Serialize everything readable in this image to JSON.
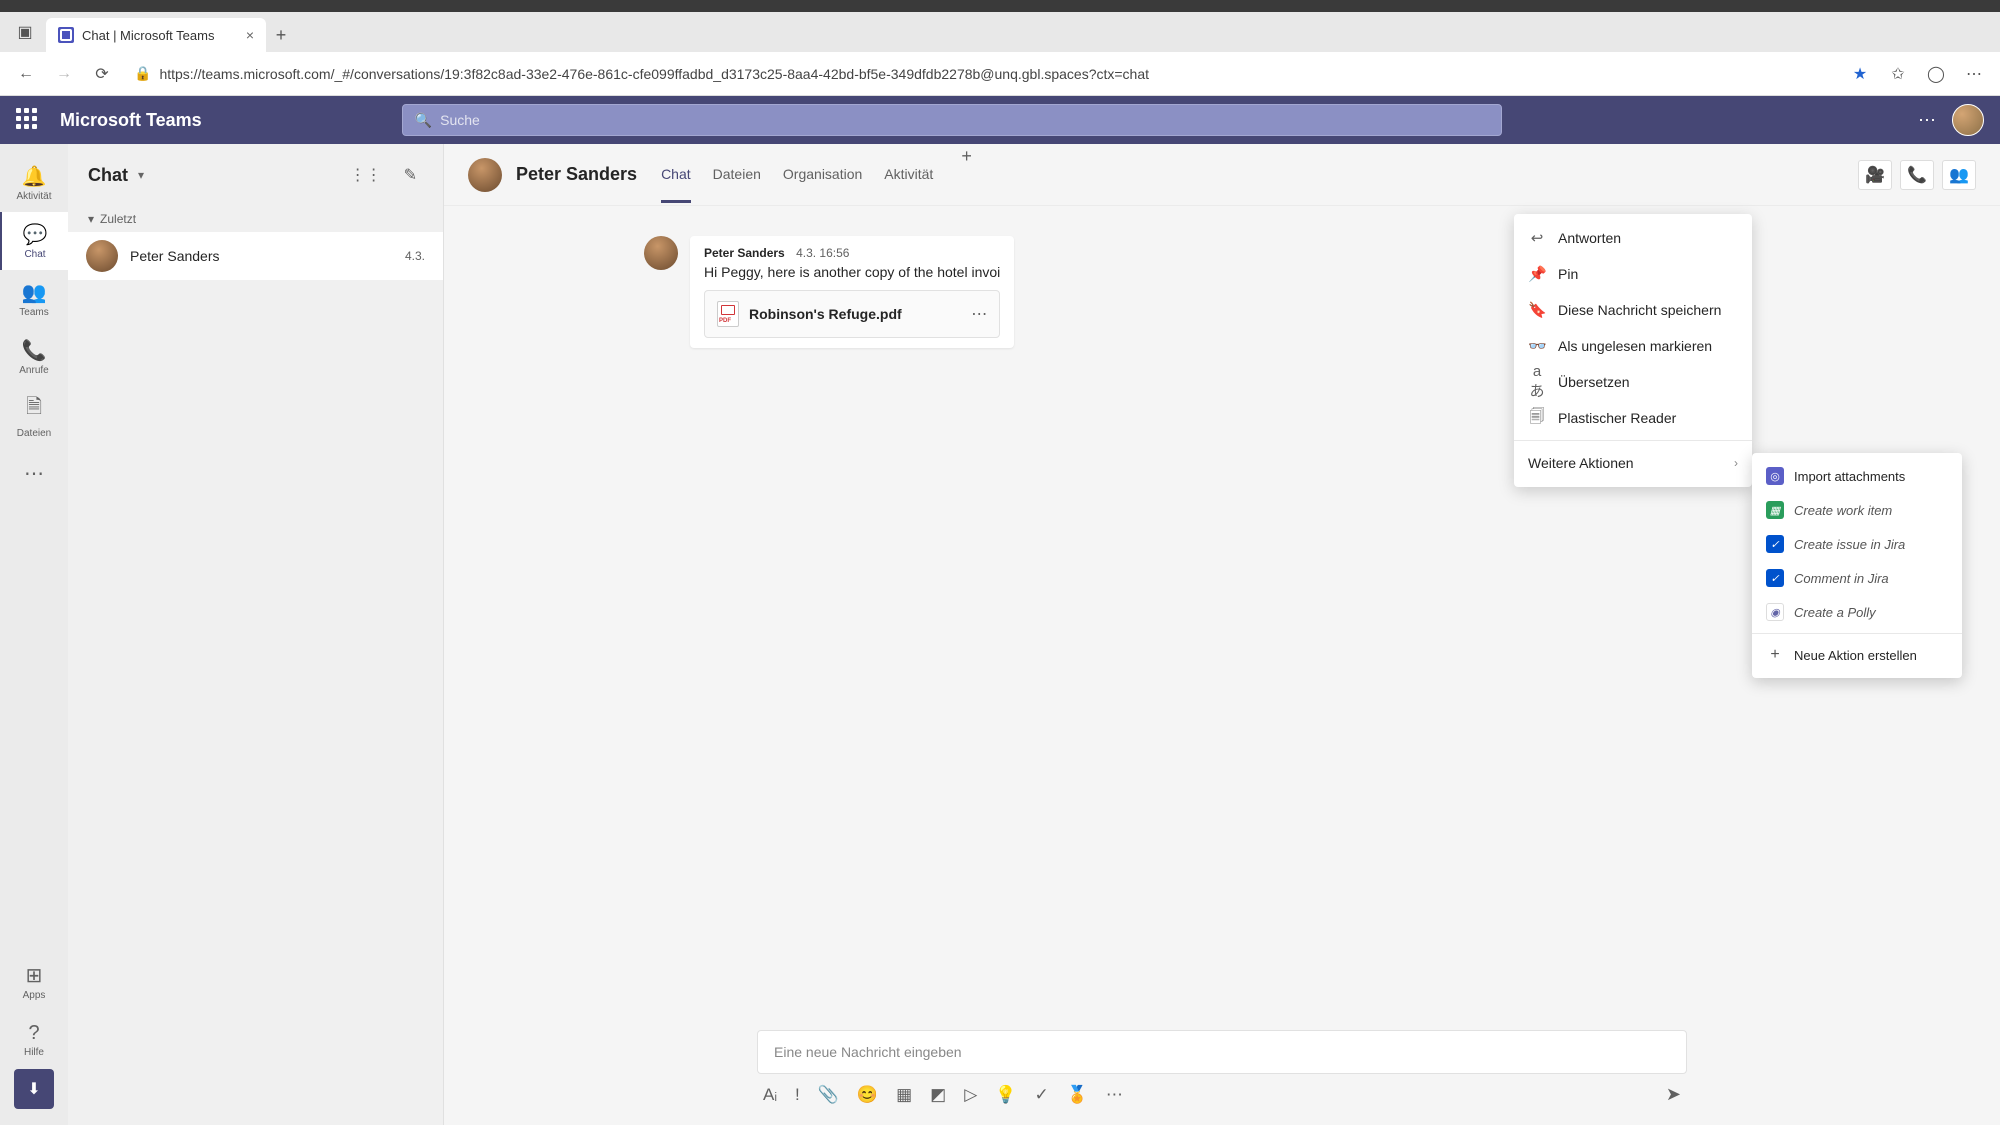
{
  "browser": {
    "tab_title": "Chat | Microsoft Teams",
    "url": "https://teams.microsoft.com/_#/conversations/19:3f82c8ad-33e2-476e-861c-cfe099ffadbd_d3173c25-8aa4-42bd-bf5e-349dfdb2278b@unq.gbl.spaces?ctx=chat"
  },
  "teams": {
    "app_title": "Microsoft Teams",
    "search_placeholder": "Suche"
  },
  "rail": {
    "activity": "Aktivität",
    "chat": "Chat",
    "teams": "Teams",
    "calls": "Anrufe",
    "files": "Dateien",
    "apps": "Apps",
    "help": "Hilfe"
  },
  "chat_panel": {
    "title": "Chat",
    "section": "Zuletzt",
    "items": [
      {
        "name": "Peter Sanders",
        "date": "4.3."
      }
    ]
  },
  "conversation": {
    "title": "Peter Sanders",
    "tabs": {
      "chat": "Chat",
      "files": "Dateien",
      "org": "Organisation",
      "activity": "Aktivität"
    },
    "message": {
      "author": "Peter Sanders",
      "timestamp": "4.3. 16:56",
      "text": "Hi Peggy, here is another copy of the hotel invoi",
      "attachment_name": "Robinson's Refuge.pdf"
    },
    "compose_placeholder": "Eine neue Nachricht eingeben"
  },
  "context_menu": {
    "reply": "Antworten",
    "pin": "Pin",
    "save": "Diese Nachricht speichern",
    "unread": "Als ungelesen markieren",
    "translate": "Übersetzen",
    "reader": "Plastischer Reader",
    "more": "Weitere Aktionen"
  },
  "sub_menu": {
    "import": "Import attachments",
    "work_item": "Create work item",
    "jira_issue": "Create issue in Jira",
    "jira_comment": "Comment in Jira",
    "polly": "Create a Polly",
    "new_action": "Neue Aktion erstellen"
  }
}
